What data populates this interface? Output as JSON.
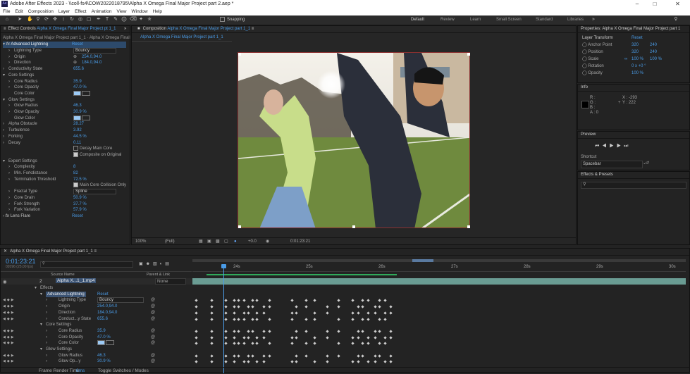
{
  "window": {
    "title": "Adobe After Effects 2023 - \\\\coll-fs4\\COW2022018795\\Alpha X Omega Final Major Project part 2.aep *",
    "logo": "Ae"
  },
  "menu": [
    "File",
    "Edit",
    "Composition",
    "Layer",
    "Effect",
    "Animation",
    "View",
    "Window",
    "Help"
  ],
  "toolbar": {
    "snapping": "Snapping",
    "workspaces": [
      "Default",
      "Review",
      "Learn",
      "Small Screen",
      "Standard",
      "Libraries"
    ]
  },
  "effect_controls": {
    "tab": "Effect Controls",
    "tab_target": "Alpha X Omega Final Major Project pt 1_1",
    "breadcrumb": "Alpha X Omega Final Major Project part 1_1 · Alpha X Omega Final Major Project",
    "effect_name": "Advanced Lightning",
    "reset": "Reset",
    "rows": [
      {
        "label": "Lightning Type",
        "value": "Bouncy",
        "kind": "select",
        "indent": 1
      },
      {
        "label": "Origin",
        "value": "254.0,94.0",
        "kind": "point",
        "indent": 1
      },
      {
        "label": "Direction",
        "value": "184.0,94.0",
        "kind": "point",
        "indent": 1
      },
      {
        "label": "Conductivity State",
        "value": "655.6",
        "kind": "num",
        "indent": 0
      },
      {
        "label": "Core Settings",
        "value": "",
        "kind": "group",
        "indent": 0
      },
      {
        "label": "Core Radius",
        "value": "35.9",
        "kind": "num",
        "indent": 1
      },
      {
        "label": "Core Opacity",
        "value": "47.0 %",
        "kind": "num",
        "indent": 1
      },
      {
        "label": "Core Color",
        "value": "",
        "kind": "color",
        "indent": 1
      },
      {
        "label": "Glow Settings",
        "value": "",
        "kind": "group",
        "indent": 0
      },
      {
        "label": "Glow Radius",
        "value": "46.3",
        "kind": "num",
        "indent": 1
      },
      {
        "label": "Glow Opacity",
        "value": "30.9 %",
        "kind": "num",
        "indent": 1
      },
      {
        "label": "Glow Color",
        "value": "",
        "kind": "color",
        "indent": 1
      },
      {
        "label": "Alpha Obstacle",
        "value": "28.27",
        "kind": "num",
        "indent": 0
      },
      {
        "label": "Turbulence",
        "value": "3.92",
        "kind": "num",
        "indent": 0
      },
      {
        "label": "Forking",
        "value": "44.5 %",
        "kind": "num",
        "indent": 0
      },
      {
        "label": "Decay",
        "value": "0.11",
        "kind": "num",
        "indent": 0
      },
      {
        "label": "",
        "value": "Decay Main Core",
        "kind": "check",
        "indent": 0
      },
      {
        "label": "",
        "value": "Composite on Original",
        "kind": "checked",
        "indent": 0
      },
      {
        "label": "Expert Settings",
        "value": "",
        "kind": "group",
        "indent": 0
      },
      {
        "label": "Complexity",
        "value": "8",
        "kind": "num",
        "indent": 1
      },
      {
        "label": "Min. Forkdistance",
        "value": "82",
        "kind": "num",
        "indent": 1
      },
      {
        "label": "Termination Threshold",
        "value": "72.5 %",
        "kind": "num",
        "indent": 1
      },
      {
        "label": "",
        "value": "Main Core Collision Only",
        "kind": "checked",
        "indent": 1
      },
      {
        "label": "Fractal Type",
        "value": "Spline",
        "kind": "select",
        "indent": 1
      },
      {
        "label": "Core Drain",
        "value": "50.9 %",
        "kind": "num",
        "indent": 1
      },
      {
        "label": "Fork Strength",
        "value": "37.7 %",
        "kind": "num",
        "indent": 1
      },
      {
        "label": "Fork Variation",
        "value": "57.9 %",
        "kind": "num",
        "indent": 1
      }
    ],
    "lens_flare": "Lens Flare",
    "lens_reset": "Reset"
  },
  "composition": {
    "tab": "Composition",
    "tab_target": "Alpha X Omega Final Major Project part 1_1",
    "subtab": "Alpha X Omega Final Major Project part 1_1",
    "zoom": "100%",
    "resolution": "(Full)",
    "exposure": "+0.0",
    "timecode": "0:01:23:21"
  },
  "properties": {
    "title": "Properties: Alpha X Omega Final Major Project part 1",
    "section": "Layer Transform",
    "reset": "Reset",
    "rows": [
      {
        "label": "Anchor Point",
        "v1": "320",
        "v2": "240"
      },
      {
        "label": "Position",
        "v1": "320",
        "v2": "240"
      },
      {
        "label": "Scale",
        "v1": "100 %",
        "v2": "100 %"
      },
      {
        "label": "Rotation",
        "v1": "0 x +0 °",
        "v2": ""
      },
      {
        "label": "Opacity",
        "v1": "100 %",
        "v2": ""
      }
    ]
  },
  "info": {
    "title": "Info",
    "r": "R :",
    "g": "G :",
    "b": "B :",
    "a": "A : 0",
    "x": "X : -293",
    "y": "Y : 222"
  },
  "preview": {
    "title": "Preview",
    "shortcut_label": "Shortcut",
    "shortcut": "Spacebar"
  },
  "effects_presets": {
    "title": "Effects & Presets",
    "search_placeholder": ""
  },
  "timeline": {
    "tab": "Alpha X Omega Final Major Project part 1_1",
    "timecode": "0:01:23:21",
    "frames": "02096 (25.00 fps)",
    "col_source": "Source Name",
    "col_parent": "Parent & Link",
    "ruler": [
      "24s",
      "25s",
      "26s",
      "27s",
      "28s",
      "29s",
      "30s"
    ],
    "layer_num": "2",
    "layer_name": "Alpha X...1_1.mp4",
    "parent": "None",
    "rows": [
      {
        "label": "Effects",
        "value": "",
        "indent": 1
      },
      {
        "label": "Advanced Lightning",
        "value": "Reset",
        "indent": 2
      },
      {
        "label": "Lightning Type",
        "value": "Bouncy",
        "indent": 3
      },
      {
        "label": "Origin",
        "value": "254.0,94.0",
        "indent": 3
      },
      {
        "label": "Direction",
        "value": "184.0,94.0",
        "indent": 3
      },
      {
        "label": "Conduct...y State",
        "value": "655.6",
        "indent": 3
      },
      {
        "label": "Core Settings",
        "value": "",
        "indent": 2
      },
      {
        "label": "Core Radius",
        "value": "35.9",
        "indent": 3
      },
      {
        "label": "Core Opacity",
        "value": "47.0 %",
        "indent": 3
      },
      {
        "label": "Core Color",
        "value": "",
        "indent": 3
      },
      {
        "label": "Glow Settings",
        "value": "",
        "indent": 2
      },
      {
        "label": "Glow Radius",
        "value": "46.3",
        "indent": 3
      },
      {
        "label": "Glow Op...y",
        "value": "30.9 %",
        "indent": 3
      }
    ],
    "footer_render": "Frame Render Time",
    "footer_ms": "6ms",
    "footer_toggle": "Toggle Switches / Modes"
  },
  "colors": {
    "accent": "#4a9ce8",
    "core_color": "#9ccaf5",
    "layer_bar": "#6a9c93"
  }
}
